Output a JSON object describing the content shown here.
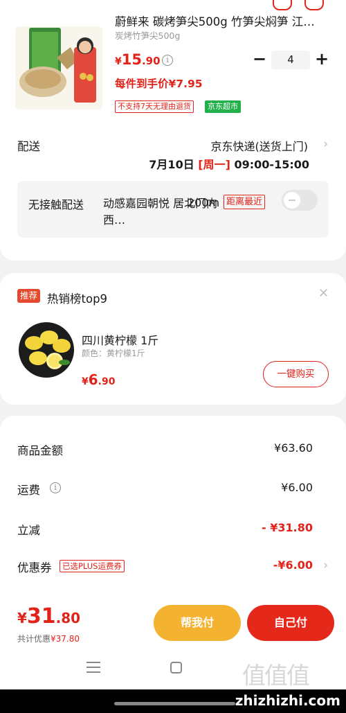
{
  "product": {
    "title": "蔚鲜来 碳烤笋尖500g 竹笋尖焖笋 江…",
    "spec": "炭烤竹笋尖500g",
    "price_currency": "¥",
    "price_int": "15",
    "price_dec": ".90",
    "quantity": "4",
    "per_unit_price": "每件到手价¥7.95",
    "tag_no_return": "不支持7天无理由退货",
    "tag_store": "京东超市",
    "image_caption": "碳烤笋尖"
  },
  "delivery": {
    "label": "配送",
    "method": "京东快递(送货上门)",
    "date": "7月10日",
    "weekday": "[周一]",
    "time": "09:00-15:00"
  },
  "contactless": {
    "label": "无接触配送",
    "address": "动感嘉园朝悦 居北门内西…",
    "distance": "200m",
    "nearest_tag": "距离最近"
  },
  "recommend": {
    "tag": "推荐",
    "title": "热销榜top9",
    "item_name": "四川黄柠檬 1斤",
    "item_color": "颜色：黄柠檬1斤",
    "price_currency": "¥",
    "price_int": "6",
    "price_dec": ".90",
    "buy_label": "一键购买"
  },
  "summary": {
    "goods_label": "商品金额",
    "goods_value": "¥63.60",
    "shipping_label": "运费",
    "shipping_value": "¥6.00",
    "discount_label": "立减",
    "discount_value": "- ¥31.80",
    "coupon_label": "优惠券",
    "coupon_tag": "已选PLUS运费券",
    "coupon_value": "-¥6.00"
  },
  "bottom": {
    "total_currency": "¥",
    "total_int": "31",
    "total_dec": ".80",
    "discount_label": "共计优惠",
    "discount_amount": "¥37.80",
    "help_pay": "帮我付",
    "self_pay": "自己付"
  },
  "footer": {
    "watermark": "值值值",
    "url": "zhizhizhi.com"
  },
  "colors": {
    "accent_red": "#e2231a",
    "help_btn": "#f3b230",
    "jd_green": "#21b04a"
  }
}
